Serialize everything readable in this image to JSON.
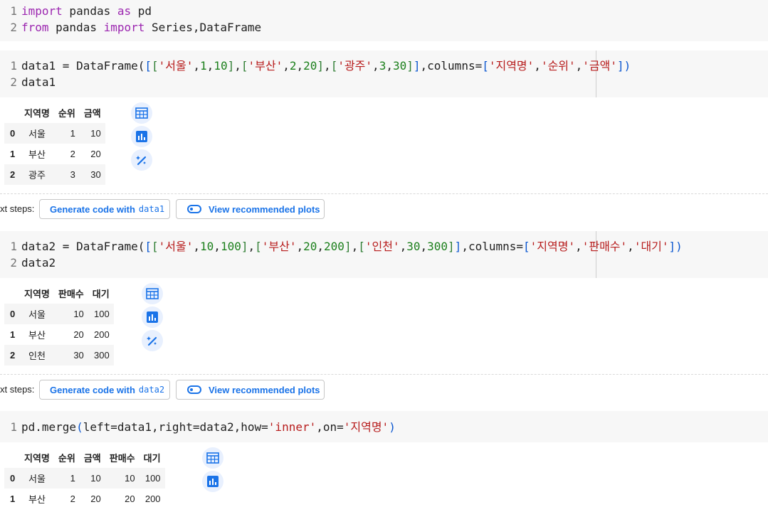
{
  "cells": {
    "cell1": {
      "lines": [
        [
          {
            "t": "import",
            "c": "kw"
          },
          {
            "t": " pandas "
          },
          {
            "t": "as",
            "c": "kw"
          },
          {
            "t": " pd"
          }
        ],
        [
          {
            "t": "from",
            "c": "kw"
          },
          {
            "t": " pandas "
          },
          {
            "t": "import",
            "c": "kw"
          },
          {
            "t": " Series,DataFrame"
          }
        ]
      ]
    },
    "cell2": {
      "lines": [
        [
          {
            "t": "data1 = DataFrame("
          },
          {
            "t": "[",
            "c": "bk1"
          },
          {
            "t": "[",
            "c": "bk2"
          },
          {
            "t": "'서울'",
            "c": "str"
          },
          {
            "t": ","
          },
          {
            "t": "1",
            "c": "num"
          },
          {
            "t": ","
          },
          {
            "t": "10",
            "c": "num"
          },
          {
            "t": "]",
            "c": "bk2"
          },
          {
            "t": ","
          },
          {
            "t": "[",
            "c": "bk2"
          },
          {
            "t": "'부산'",
            "c": "str"
          },
          {
            "t": ","
          },
          {
            "t": "2",
            "c": "num"
          },
          {
            "t": ","
          },
          {
            "t": "20",
            "c": "num"
          },
          {
            "t": "]",
            "c": "bk2"
          },
          {
            "t": ","
          },
          {
            "t": "[",
            "c": "bk2"
          },
          {
            "t": "'광주'",
            "c": "str"
          },
          {
            "t": ","
          },
          {
            "t": "3",
            "c": "num"
          },
          {
            "t": ","
          },
          {
            "t": "30",
            "c": "num"
          },
          {
            "t": "]",
            "c": "bk2"
          },
          {
            "t": "]",
            "c": "bk1"
          },
          {
            "t": ",columns="
          },
          {
            "t": "[",
            "c": "bk1"
          },
          {
            "t": "'지역명'",
            "c": "str"
          },
          {
            "t": ","
          },
          {
            "t": "'순위'",
            "c": "str"
          },
          {
            "t": ","
          },
          {
            "t": "'금액'",
            "c": "str"
          },
          {
            "t": "]",
            "c": "bk1"
          },
          {
            "t": ")",
            "c": "bk1"
          }
        ],
        [
          {
            "t": "data1"
          }
        ]
      ]
    },
    "cell3": {
      "lines": [
        [
          {
            "t": "data2 = DataFrame("
          },
          {
            "t": "[",
            "c": "bk1"
          },
          {
            "t": "[",
            "c": "bk2"
          },
          {
            "t": "'서울'",
            "c": "str"
          },
          {
            "t": ","
          },
          {
            "t": "10",
            "c": "num"
          },
          {
            "t": ","
          },
          {
            "t": "100",
            "c": "num"
          },
          {
            "t": "]",
            "c": "bk2"
          },
          {
            "t": ","
          },
          {
            "t": "[",
            "c": "bk2"
          },
          {
            "t": "'부산'",
            "c": "str"
          },
          {
            "t": ","
          },
          {
            "t": "20",
            "c": "num"
          },
          {
            "t": ","
          },
          {
            "t": "200",
            "c": "num"
          },
          {
            "t": "]",
            "c": "bk2"
          },
          {
            "t": ","
          },
          {
            "t": "[",
            "c": "bk2"
          },
          {
            "t": "'인천'",
            "c": "str"
          },
          {
            "t": ","
          },
          {
            "t": "30",
            "c": "num"
          },
          {
            "t": ","
          },
          {
            "t": "300",
            "c": "num"
          },
          {
            "t": "]",
            "c": "bk2"
          },
          {
            "t": "]",
            "c": "bk1"
          },
          {
            "t": ",columns="
          },
          {
            "t": "[",
            "c": "bk1"
          },
          {
            "t": "'지역명'",
            "c": "str"
          },
          {
            "t": ","
          },
          {
            "t": "'판매수'",
            "c": "str"
          },
          {
            "t": ","
          },
          {
            "t": "'대기'",
            "c": "str"
          },
          {
            "t": "]",
            "c": "bk1"
          },
          {
            "t": ")",
            "c": "bk1"
          }
        ],
        [
          {
            "t": "data2"
          }
        ]
      ]
    },
    "cell4": {
      "lines": [
        [
          {
            "t": "pd.merge"
          },
          {
            "t": "(",
            "c": "bk1"
          },
          {
            "t": "left=data1,right=data2,how="
          },
          {
            "t": "'inner'",
            "c": "str"
          },
          {
            "t": ",on="
          },
          {
            "t": "'지역명'",
            "c": "str"
          },
          {
            "t": ")",
            "c": "bk1"
          }
        ]
      ]
    }
  },
  "tables": {
    "t1": {
      "columns": [
        "지역명",
        "순위",
        "금액"
      ],
      "rows": [
        {
          "index": "0",
          "cells": [
            "서울",
            "1",
            "10"
          ]
        },
        {
          "index": "1",
          "cells": [
            "부산",
            "2",
            "20"
          ]
        },
        {
          "index": "2",
          "cells": [
            "광주",
            "3",
            "30"
          ]
        }
      ]
    },
    "t2": {
      "columns": [
        "지역명",
        "판매수",
        "대기"
      ],
      "rows": [
        {
          "index": "0",
          "cells": [
            "서울",
            "10",
            "100"
          ]
        },
        {
          "index": "1",
          "cells": [
            "부산",
            "20",
            "200"
          ]
        },
        {
          "index": "2",
          "cells": [
            "인천",
            "30",
            "300"
          ]
        }
      ]
    },
    "t3": {
      "columns": [
        "지역명",
        "순위",
        "금액",
        "판매수",
        "대기"
      ],
      "rows": [
        {
          "index": "0",
          "cells": [
            "서울",
            "1",
            "10",
            "10",
            "100"
          ]
        },
        {
          "index": "1",
          "cells": [
            "부산",
            "2",
            "20",
            "20",
            "200"
          ]
        }
      ]
    }
  },
  "next_steps": {
    "label": "xt steps:",
    "generate_prefix": "Generate code with",
    "generate_var1": "data1",
    "generate_var2": "data2",
    "view_plots": "View recommended plots"
  },
  "icons": {
    "table": "table-icon",
    "chart": "bar-chart-icon",
    "magic": "magic-wand-icon"
  },
  "colors": {
    "accent": "#1a73e8",
    "keyword": "#9c27b0",
    "string": "#b71c1c",
    "number": "#1b7f1b"
  }
}
